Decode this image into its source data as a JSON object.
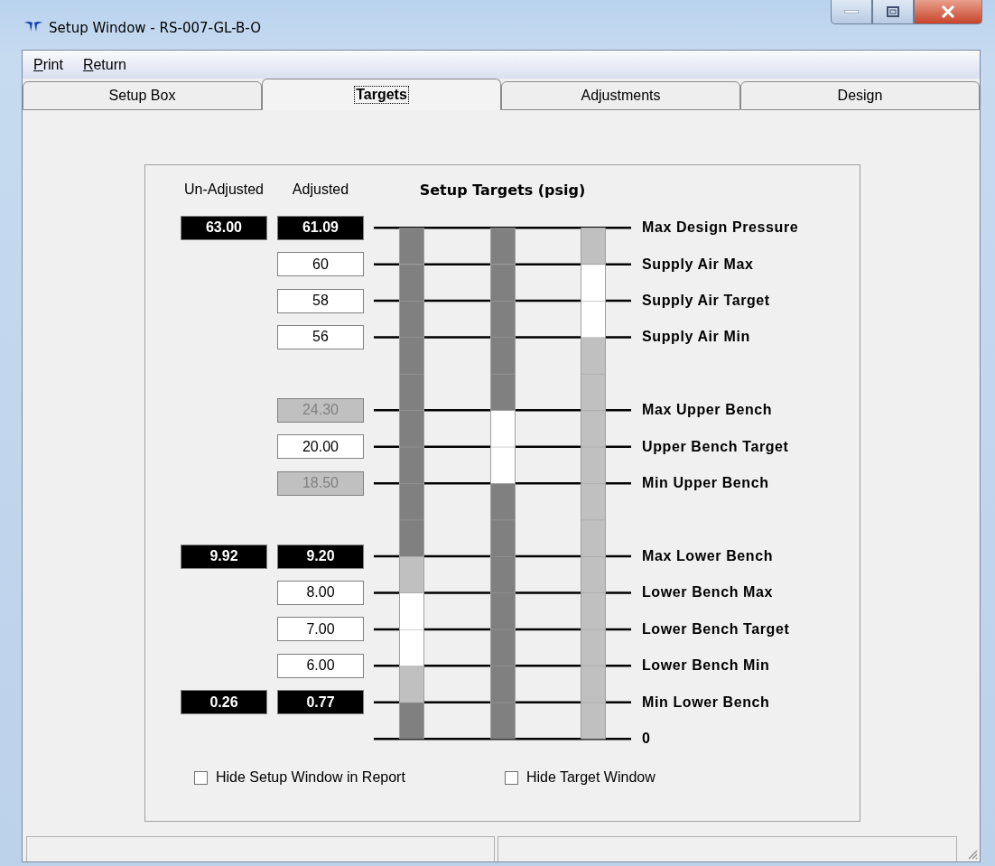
{
  "window": {
    "title": "Setup Window - RS-007-GL-B-O"
  },
  "menu": [
    "Print",
    "Return"
  ],
  "tabs": [
    {
      "label": "Setup Box",
      "selected": false
    },
    {
      "label": "Targets",
      "selected": true
    },
    {
      "label": "Adjustments",
      "selected": false
    },
    {
      "label": "Design",
      "selected": false
    }
  ],
  "targets": {
    "headers": {
      "unadjusted": "Un-Adjusted",
      "adjusted": "Adjusted",
      "title": "Setup Targets (psig)"
    },
    "rows": [
      {
        "label": "Max Design Pressure",
        "unadjusted": "63.00",
        "adjusted": {
          "value": "61.09",
          "kind": "readout"
        }
      },
      {
        "label": "Supply Air Max",
        "adjusted": {
          "value": "60",
          "kind": "input"
        }
      },
      {
        "label": "Supply Air Target",
        "adjusted": {
          "value": "58",
          "kind": "input"
        }
      },
      {
        "label": "Supply Air Min",
        "adjusted": {
          "value": "56",
          "kind": "input"
        }
      },
      {},
      {
        "label": "Max Upper Bench",
        "adjusted": {
          "value": "24.30",
          "kind": "disabled"
        }
      },
      {
        "label": "Upper Bench Target",
        "adjusted": {
          "value": "20.00",
          "kind": "input"
        }
      },
      {
        "label": "Min Upper Bench",
        "adjusted": {
          "value": "18.50",
          "kind": "disabled"
        }
      },
      {},
      {
        "label": "Max Lower Bench",
        "unadjusted": "9.92",
        "adjusted": {
          "value": "9.20",
          "kind": "readout"
        }
      },
      {
        "label": "Lower Bench Max",
        "adjusted": {
          "value": "8.00",
          "kind": "input"
        }
      },
      {
        "label": "Lower Bench Target",
        "adjusted": {
          "value": "7.00",
          "kind": "input"
        }
      },
      {
        "label": "Lower Bench Min",
        "adjusted": {
          "value": "6.00",
          "kind": "input"
        }
      },
      {
        "label": "Min Lower Bench",
        "unadjusted": "0.26",
        "adjusted": {
          "value": "0.77",
          "kind": "readout"
        }
      },
      {
        "label": "0"
      }
    ],
    "bars": [
      {
        "segments": [
          {
            "color": "#808080"
          },
          {
            "color": "#808080"
          },
          {
            "color": "#808080"
          },
          {
            "color": "#808080"
          },
          {
            "color": "#808080"
          },
          {
            "color": "#808080"
          },
          {
            "color": "#808080"
          },
          {
            "color": "#808080"
          },
          {
            "color": "#808080"
          },
          {
            "color": "#c0c0c0"
          },
          {
            "color": "#ffffff"
          },
          {
            "color": "#ffffff"
          },
          {
            "color": "#c0c0c0"
          },
          {
            "color": "#808080"
          }
        ]
      },
      {
        "segments": [
          {
            "color": "#808080"
          },
          {
            "color": "#808080"
          },
          {
            "color": "#808080"
          },
          {
            "color": "#808080"
          },
          {
            "color": "#808080"
          },
          {
            "color": "#ffffff"
          },
          {
            "color": "#ffffff"
          },
          {
            "color": "#808080"
          },
          {
            "color": "#808080"
          },
          {
            "color": "#808080"
          },
          {
            "color": "#808080"
          },
          {
            "color": "#808080"
          },
          {
            "color": "#808080"
          },
          {
            "color": "#808080"
          }
        ]
      },
      {
        "segments": [
          {
            "color": "#c0c0c0"
          },
          {
            "color": "#ffffff"
          },
          {
            "color": "#ffffff"
          },
          {
            "color": "#c0c0c0"
          },
          {
            "color": "#c0c0c0"
          },
          {
            "color": "#c0c0c0"
          },
          {
            "color": "#c0c0c0"
          },
          {
            "color": "#c0c0c0"
          },
          {
            "color": "#c0c0c0"
          },
          {
            "color": "#c0c0c0"
          },
          {
            "color": "#c0c0c0"
          },
          {
            "color": "#c0c0c0"
          },
          {
            "color": "#c0c0c0"
          },
          {
            "color": "#c0c0c0"
          }
        ]
      }
    ],
    "checkboxes": [
      {
        "label": "Hide Setup Window in Report",
        "checked": false
      },
      {
        "label": "Hide Target Window",
        "checked": false
      }
    ]
  }
}
